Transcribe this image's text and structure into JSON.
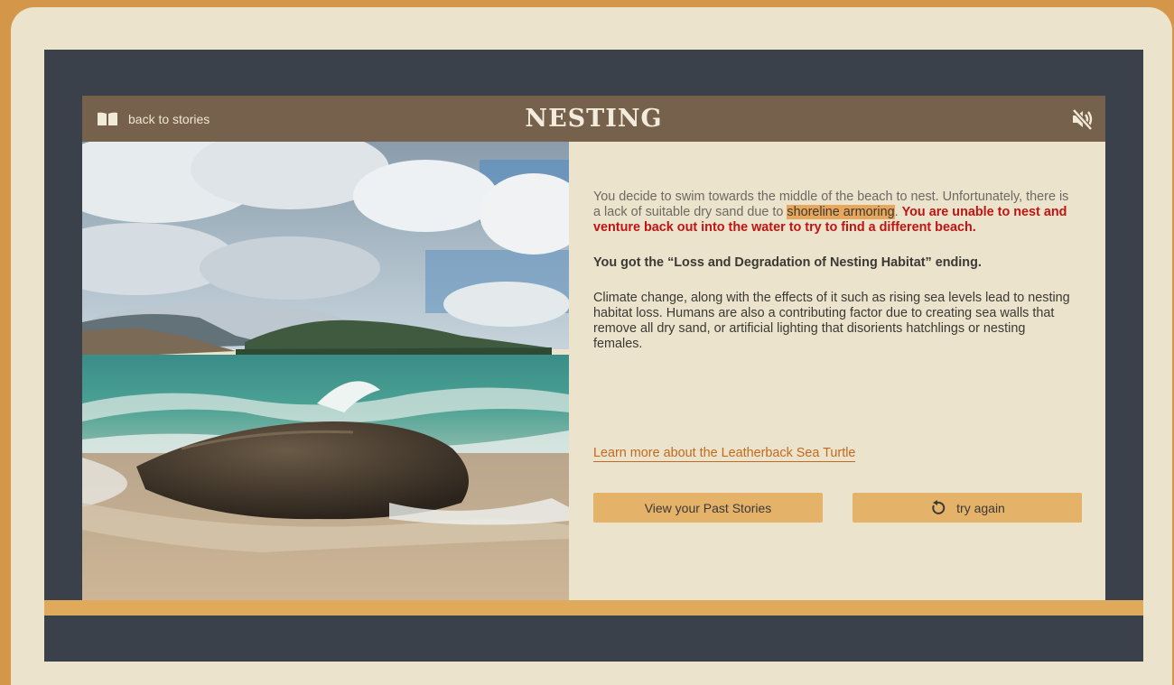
{
  "header": {
    "back_label": "back to stories",
    "title": "NESTING"
  },
  "story": {
    "intro_before": "You decide to swim towards the middle of the beach to nest. Unfortunately, there is a lack of suitable dry sand due to ",
    "highlight": "shoreline armoring",
    "after_highlight": ".",
    "warning": "You are unable to nest and venture back out into the water to try to find a different beach.",
    "ending": "You got the “Loss and Degradation of Nesting Habitat” ending.",
    "explanation": "Climate change, along with the effects of it such as rising sea levels lead to nesting habitat loss. Humans are also a contributing factor due to creating sea walls that remove all dry sand, or artificial lighting that disorients hatchlings or nesting females."
  },
  "links": {
    "learn_more": "Learn more about the Leatherback Sea Turtle"
  },
  "buttons": {
    "past_stories": "View your Past Stories",
    "try_again": "try again"
  },
  "icons": {
    "back": "book-icon",
    "mute": "speaker-muted-icon",
    "retry": "refresh-icon"
  },
  "colors": {
    "header": "#75614c",
    "card": "#ebe3cb",
    "accent": "#e5b26a",
    "highlight": "#e8a75a",
    "warning": "#c01414",
    "link": "#c46a1f",
    "stage": "#3a414b"
  }
}
